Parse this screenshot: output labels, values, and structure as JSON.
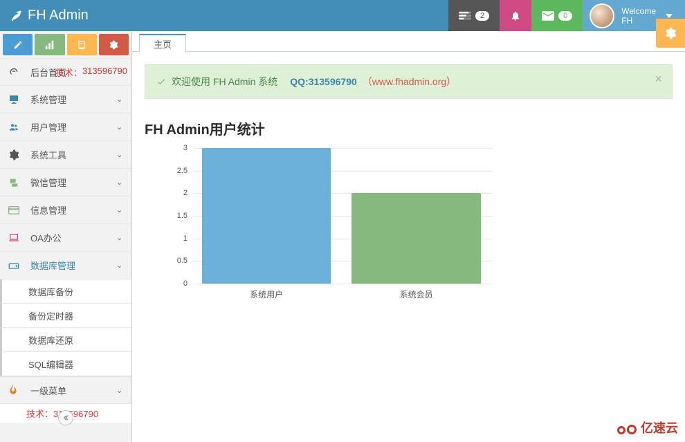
{
  "brand": "FH Admin",
  "nav": {
    "tasks_count": "2",
    "env_count": "0",
    "welcome_line1": "Welcome",
    "welcome_line2": "FH"
  },
  "sidebar": {
    "tech_prefix": "技术：",
    "tech_id": "313596790",
    "items": [
      {
        "icon": "dashboard-icon",
        "label": "后台首页",
        "expandable": false
      },
      {
        "icon": "desktop-icon",
        "label": "系统管理",
        "expandable": true
      },
      {
        "icon": "users-icon",
        "label": "用户管理",
        "expandable": true
      },
      {
        "icon": "gear-icon",
        "label": "系统工具",
        "expandable": true
      },
      {
        "icon": "comments-icon",
        "label": "微信管理",
        "expandable": true
      },
      {
        "icon": "credit-card-icon",
        "label": "信息管理",
        "expandable": true
      },
      {
        "icon": "laptop-icon",
        "label": "OA办公",
        "expandable": true
      },
      {
        "icon": "hdd-icon",
        "label": "数据库管理",
        "expandable": true,
        "active": true
      },
      {
        "icon": "fire-icon",
        "label": "一级菜单",
        "expandable": true
      }
    ],
    "submenu_db": [
      "数据库备份",
      "备份定时器",
      "数据库还原",
      "SQL编辑器"
    ],
    "tech2": "技术：313596790"
  },
  "tabs": {
    "home": "主页"
  },
  "alert": {
    "welcome": "欢迎使用 FH Admin 系统",
    "qq": "QQ:313596790",
    "link": "（www.fhadmin.org）"
  },
  "chart_title": "FH Admin用户统计",
  "chart_data": {
    "type": "bar",
    "categories": [
      "系统用户",
      "系统会员"
    ],
    "values": [
      3,
      2
    ],
    "ylim": [
      0,
      3
    ],
    "yticks": [
      0,
      0.5,
      1,
      1.5,
      2,
      2.5,
      3
    ],
    "colors": [
      "#6bb0d8",
      "#87b87f"
    ]
  },
  "watermark": "亿速云"
}
